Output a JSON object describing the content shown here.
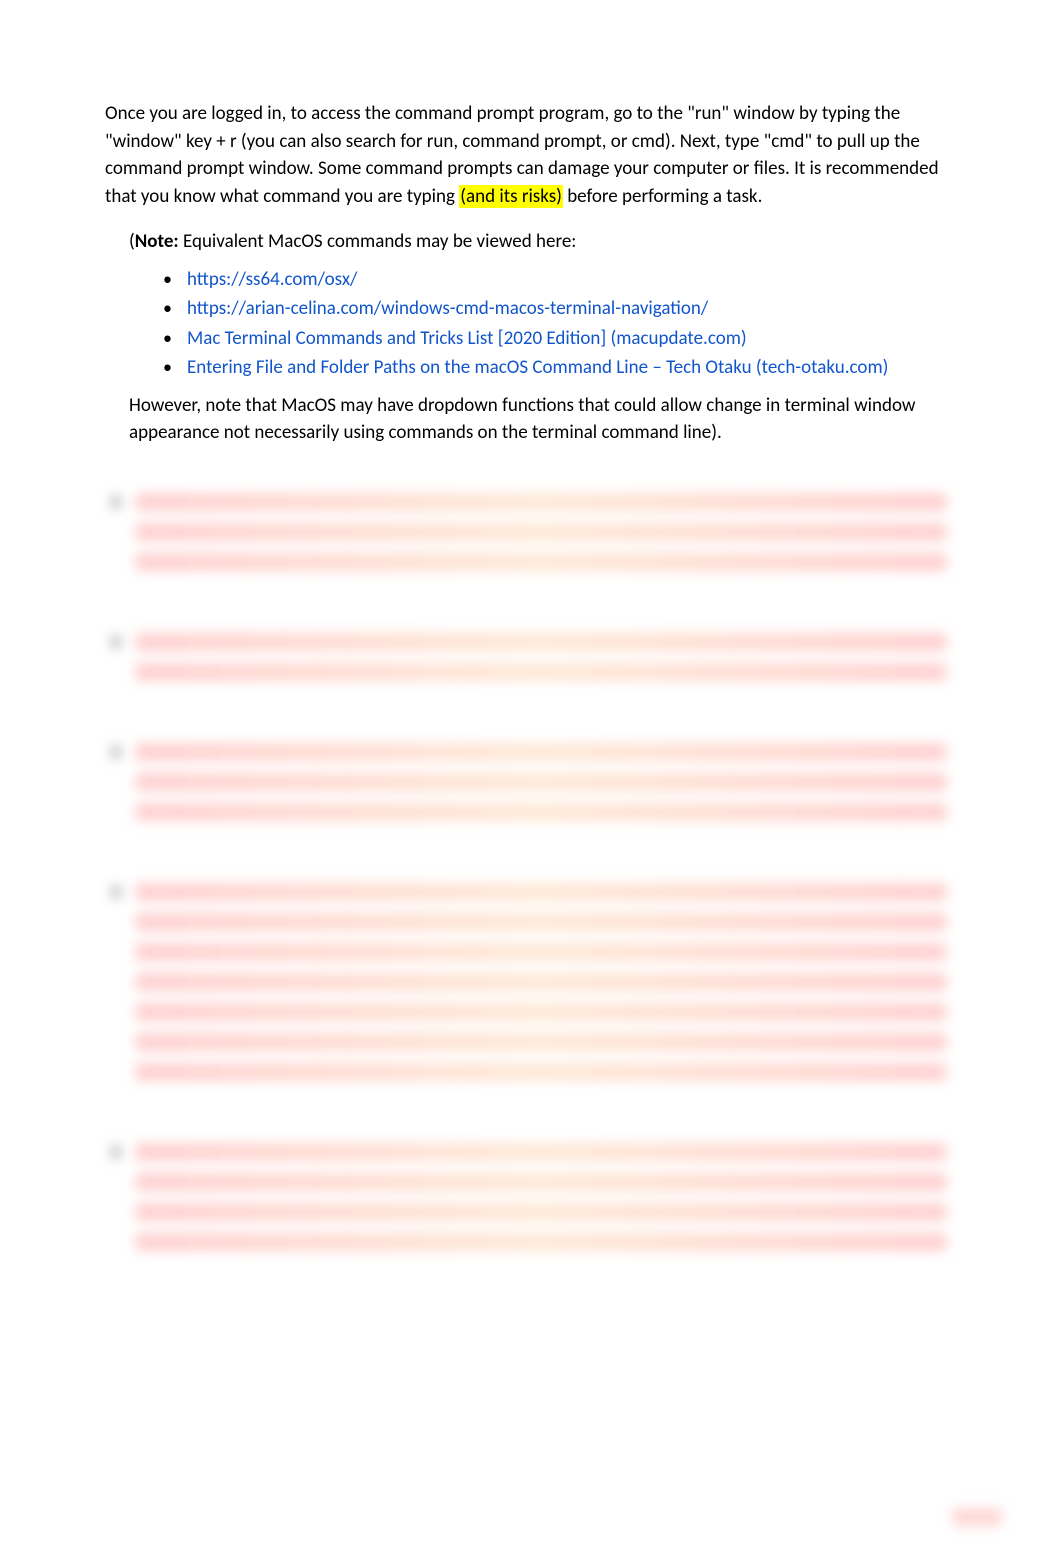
{
  "intro": {
    "pre_highlight": "Once you are logged in, to access the command prompt program, go to the \"run\" window by typing the \"window\" key + r (you can also search for run, command prompt, or cmd).  Next, type \"cmd\" to pull up the command prompt window.  Some command prompts can damage your computer or files.  It is recommended that you know what command you are typing ",
    "highlight": "(and its risks)",
    "post_highlight": " before performing a task."
  },
  "note": {
    "label": "Note:",
    "paren_open": "(",
    "text": " Equivalent MacOS commands may be viewed here:"
  },
  "links": [
    {
      "label": "https://ss64.com/osx/"
    },
    {
      "label": "https://arian-celina.com/windows-cmd-macos-terminal-navigation/"
    },
    {
      "label": "Mac Terminal Commands and Tricks List [2020 Edition] (macupdate.com)"
    },
    {
      "label": "Entering File and Folder Paths on the macOS Command Line – Tech Otaku (tech-otaku.com)"
    }
  ],
  "closing": "However, note that MacOS may have dropdown functions that could allow change in terminal window appearance not necessarily using commands on the terminal command line).",
  "blurred_items": [
    {
      "lines": [
        100,
        97,
        92
      ]
    },
    {
      "lines": [
        98,
        52
      ]
    },
    {
      "lines": [
        100,
        75,
        66
      ]
    },
    {
      "lines": [
        96,
        98,
        100,
        97,
        80,
        70,
        72
      ]
    },
    {
      "lines": [
        94,
        30,
        100,
        100
      ]
    }
  ]
}
